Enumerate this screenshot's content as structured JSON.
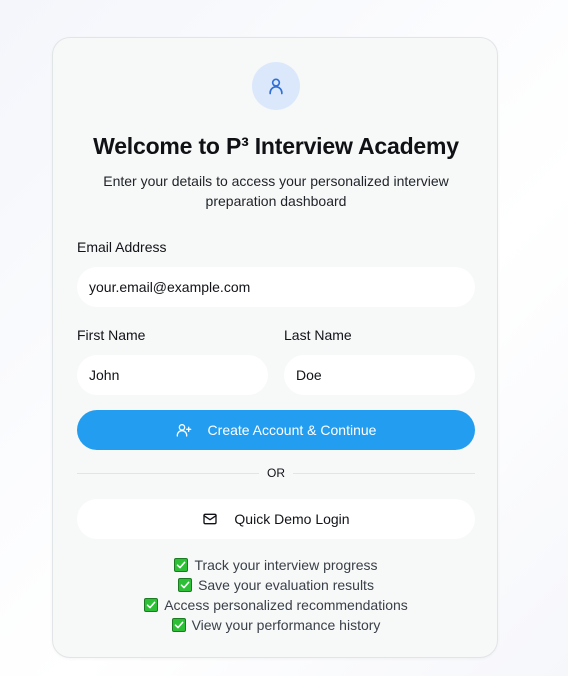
{
  "header": {
    "avatar_icon": "user-icon",
    "title": "Welcome to P³ Interview Academy",
    "subtitle": "Enter your details to access your personalized interview preparation dashboard"
  },
  "form": {
    "email": {
      "label": "Email Address",
      "value": "your.email@example.com"
    },
    "first_name": {
      "label": "First Name",
      "value": "John"
    },
    "last_name": {
      "label": "Last Name",
      "value": "Doe"
    },
    "submit": {
      "label": "Create Account & Continue",
      "icon": "user-plus-icon"
    }
  },
  "divider": {
    "text": "OR"
  },
  "demo": {
    "label": "Quick Demo Login",
    "icon": "mail-icon"
  },
  "features": [
    "Track your interview progress",
    "Save your evaluation results",
    "Access personalized recommendations",
    "View your performance history"
  ],
  "colors": {
    "accent": "#239def",
    "avatar_bg": "#dbe8fb",
    "check": "#2dbf36"
  }
}
